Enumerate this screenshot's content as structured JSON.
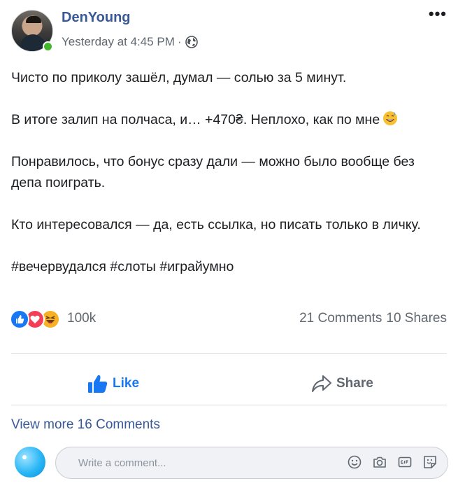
{
  "post": {
    "author": "DenYoung",
    "timestamp": "Yesterday at 4:45 PM",
    "separator": "·",
    "visibility_icon": "globe-icon",
    "more_options": "•••",
    "body": [
      "Чисто по приколу зашёл, думал — солью за 5 минут.",
      "В итоге залип на полчаса, и… +470₴. Неплохо, как по мне",
      "Понравилось, что бонус сразу дали — можно было вообще без депа поиграть.",
      "Кто интересовался — да, есть ссылка, но писать только в личку.",
      "#вечервудался #слоты #играйумно"
    ],
    "body_emoji": "grinning-sweat-emoji"
  },
  "stats": {
    "reactions": [
      "like",
      "love",
      "haha"
    ],
    "reaction_count": "100k",
    "comments": "21 Comments",
    "shares": "10 Shares"
  },
  "actions": {
    "like_label": "Like",
    "share_label": "Share"
  },
  "comments_section": {
    "view_more": "View more 16 Comments",
    "placeholder": "Write a comment..."
  },
  "colors": {
    "accent": "#1877f2",
    "link": "#385898",
    "secondary_text": "#606770",
    "online": "#42b72a"
  }
}
